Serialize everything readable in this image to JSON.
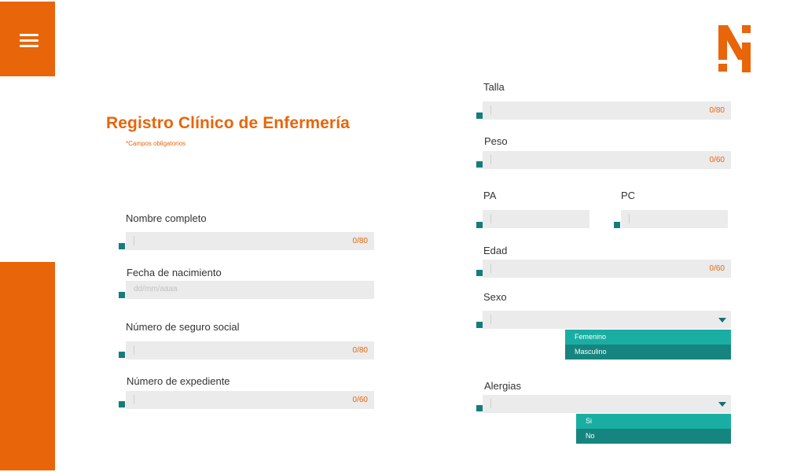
{
  "form": {
    "title": "Registro Clínico de Enfermería",
    "required_note": "*Campos obligatorios"
  },
  "left_fields": {
    "nombre": {
      "label": "Nombre completo",
      "value": "",
      "counter": "0/80"
    },
    "fecha": {
      "label": "Fecha de nacimiento",
      "placeholder": "dd/mm/aaaa"
    },
    "seguro": {
      "label": "Número de seguro social",
      "value": "",
      "counter": "0/80"
    },
    "expediente": {
      "label": "Número de expediente",
      "value": "",
      "counter": "0/60"
    }
  },
  "right_fields": {
    "talla": {
      "label": "Talla",
      "value": "",
      "counter": "0/80"
    },
    "peso": {
      "label": "Peso",
      "value": "",
      "counter": "0/60"
    },
    "pa": {
      "label": "PA",
      "value": ""
    },
    "pc": {
      "label": "PC",
      "value": ""
    },
    "edad": {
      "label": "Edad",
      "value": "",
      "counter": "0/60"
    },
    "sexo": {
      "label": "Sexo",
      "selected": "",
      "options": [
        "Femenino",
        "Masculino"
      ]
    },
    "alergias": {
      "label": "Alergias",
      "selected": "",
      "options": [
        "Si",
        "No"
      ]
    }
  },
  "icons": {
    "menu": "hamburger-menu-icon",
    "logo": "brand-n-logo",
    "dropdown": "triangle-down-icon"
  },
  "colors": {
    "accent": "#e8650a",
    "teal_marker": "#147d7b",
    "option_light": "#1aaea3",
    "option_dark": "#16857f",
    "field_bg": "#ebebeb"
  }
}
